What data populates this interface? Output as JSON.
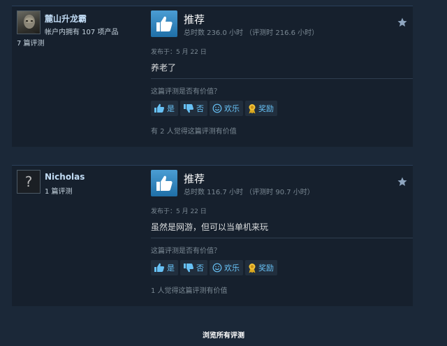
{
  "reviews": [
    {
      "author": {
        "name": "麓山升龙霸",
        "products": "帐户内拥有 107 项产品",
        "review_count": "7 篇评测"
      },
      "verdict": "推荐",
      "hours": "总时数 236.0 小时 （评测时 216.6 小时）",
      "posted": "发布于：5 月 22 日",
      "text": "养老了",
      "helpful_question": "这篇评测是否有价值？",
      "buttons": {
        "yes": "是",
        "no": "否",
        "funny": "欢乐",
        "award": "奖励"
      },
      "helpful_count": "有 2 人觉得这篇评测有价值"
    },
    {
      "author": {
        "name": "Nicholas",
        "review_count": "1 篇评测",
        "avatar_glyph": "?"
      },
      "verdict": "推荐",
      "hours": "总时数 116.7 小时 （评测时 90.7 小时）",
      "posted": "发布于：5 月 22 日",
      "text": "虽然是网游，但可以当单机来玩",
      "helpful_question": "这篇评测是否有价值？",
      "buttons": {
        "yes": "是",
        "no": "否",
        "funny": "欢乐",
        "award": "奖励"
      },
      "helpful_count": "1 人觉得这篇评测有价值"
    }
  ],
  "browse_all": "浏览所有评测",
  "colors": {
    "background": "#1b2838",
    "card": "#16202d",
    "accent": "#67c1f5",
    "thumb": "#1f6fa7"
  },
  "icons": [
    "thumbs-up-icon",
    "thumbs-down-icon",
    "smiley-icon",
    "award-icon",
    "star-icon"
  ]
}
